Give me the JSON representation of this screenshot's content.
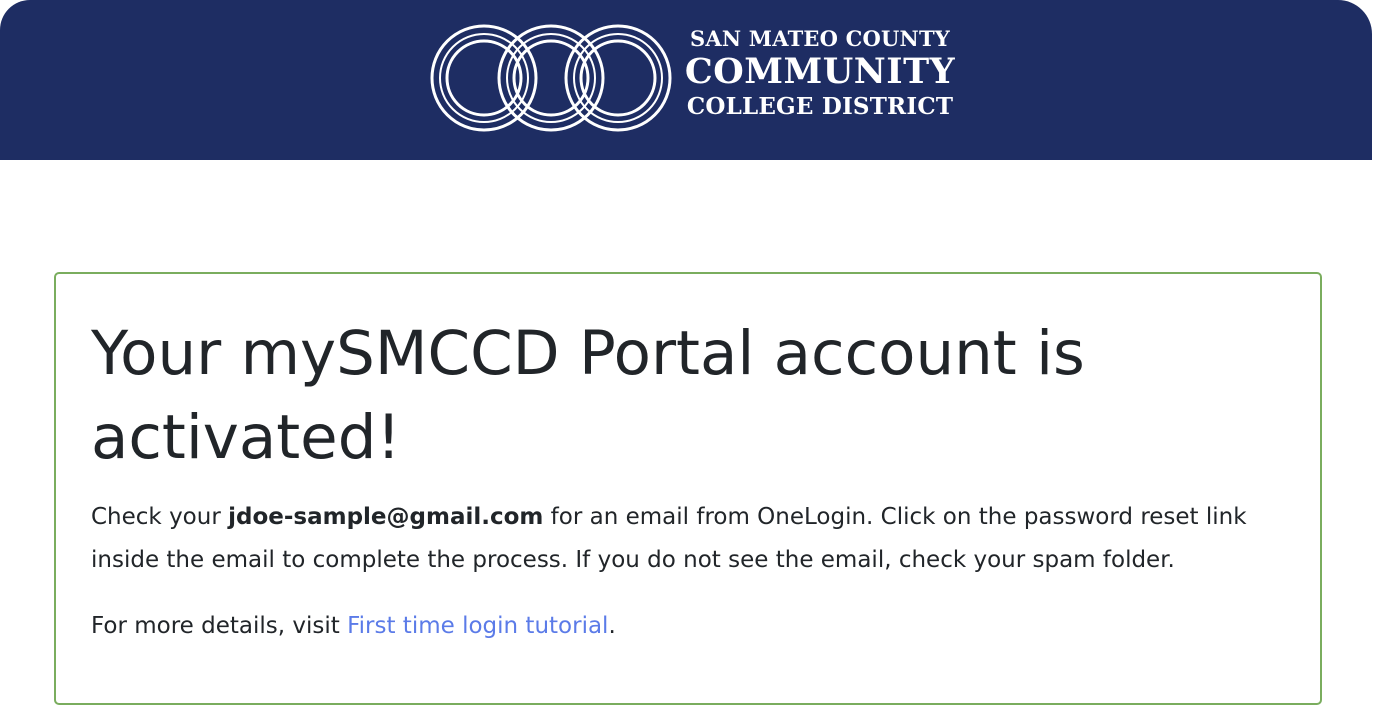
{
  "header": {
    "logo": {
      "line1": "SAN MATEO COUNTY",
      "line2": "COMMUNITY",
      "line3": "COLLEGE DISTRICT",
      "icon": "three-interlocking-rings-icon"
    },
    "background_color": "#1e2d63"
  },
  "card": {
    "border_color": "#7aad5e",
    "title": "Your mySMCCD Portal account is activated!",
    "message": {
      "prefix": "Check your ",
      "email": "jdoe-sample@gmail.com",
      "suffix": " for an email from OneLogin. Click on the password reset link inside the email to complete the process. If you do not see the email, check your spam folder."
    },
    "more_details": {
      "prefix": "For more details, visit ",
      "link_text": "First time login tutorial",
      "suffix": "."
    },
    "link_color": "#5b7be8"
  }
}
